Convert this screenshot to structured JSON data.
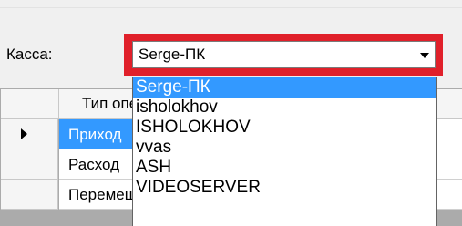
{
  "form": {
    "kassa_label": "Касса:"
  },
  "combo": {
    "selected_value": "Serge-ПК",
    "highlight_color": "#e0202a"
  },
  "dropdown": {
    "items": [
      {
        "label": "Serge-ПК",
        "selected": true
      },
      {
        "label": "isholokhov",
        "selected": false
      },
      {
        "label": "ISHOLOKHOV",
        "selected": false
      },
      {
        "label": "vvas",
        "selected": false
      },
      {
        "label": "ASH",
        "selected": false
      },
      {
        "label": "VIDEOSERVER",
        "selected": false
      }
    ],
    "selection_color": "#3399ff"
  },
  "grid": {
    "column_header": "Тип операции",
    "rows": [
      {
        "type": "Приход",
        "selected": true,
        "current": true
      },
      {
        "type": "Расход",
        "selected": false,
        "current": false
      },
      {
        "type": "Перемещение",
        "selected": false,
        "current": false
      }
    ]
  }
}
